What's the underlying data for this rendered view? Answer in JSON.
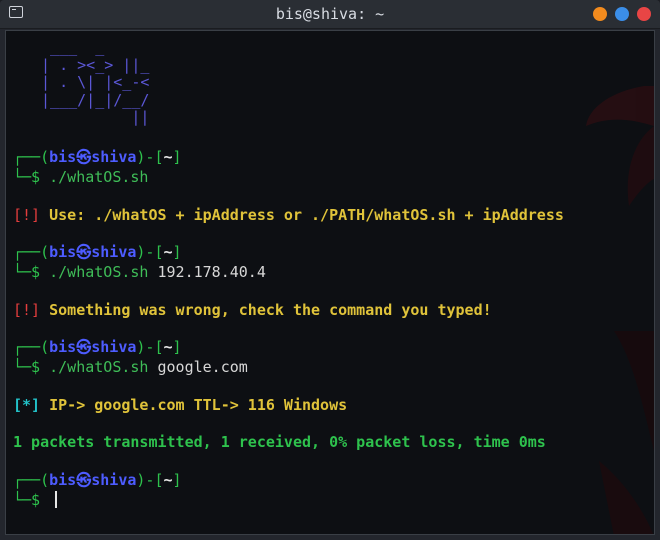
{
  "window": {
    "title": "bis@shiva: ~",
    "colors": {
      "minimize": "#f28b1e",
      "maximize": "#3b8ee8",
      "close": "#e84545"
    }
  },
  "terminal": {
    "ascii_art": "  ___  _\n | . ><_> ||_\n | . \\| |<_-<\n |___/|_|/__/\n           ||",
    "prompt": {
      "corner_top": "┌──(",
      "user": "bis",
      "at_symbol": "㉿",
      "host": "shiva",
      "mid": ")-[",
      "path": "~",
      "close": "]",
      "corner_bottom": "└─$ "
    },
    "commands": [
      {
        "cmd": "./whatOS.sh",
        "args": ""
      },
      {
        "cmd": "./whatOS.sh",
        "args": "192.178.40.4"
      },
      {
        "cmd": "./whatOS.sh",
        "args": "google.com"
      }
    ],
    "outputs": {
      "usage_tag": "[!]",
      "usage_text": "Use: ./whatOS + ipAddress or ./PATH/whatOS.sh + ipAddress",
      "error_tag": "[!]",
      "error_text": "Something was wrong, check the command you typed!",
      "result_tag": "[*]",
      "result_text": "IP-> google.com TTL-> 116 Windows",
      "ping_text": "1 packets transmitted, 1 received, 0% packet loss, time 0ms"
    },
    "colors": {
      "prompt_frame": "#2ec24d",
      "user_host": "#4d5cff",
      "warning": "#e23d3d",
      "message": "#e0c33a",
      "result": "#22c1c8",
      "ascii": "#5b57d6"
    }
  }
}
